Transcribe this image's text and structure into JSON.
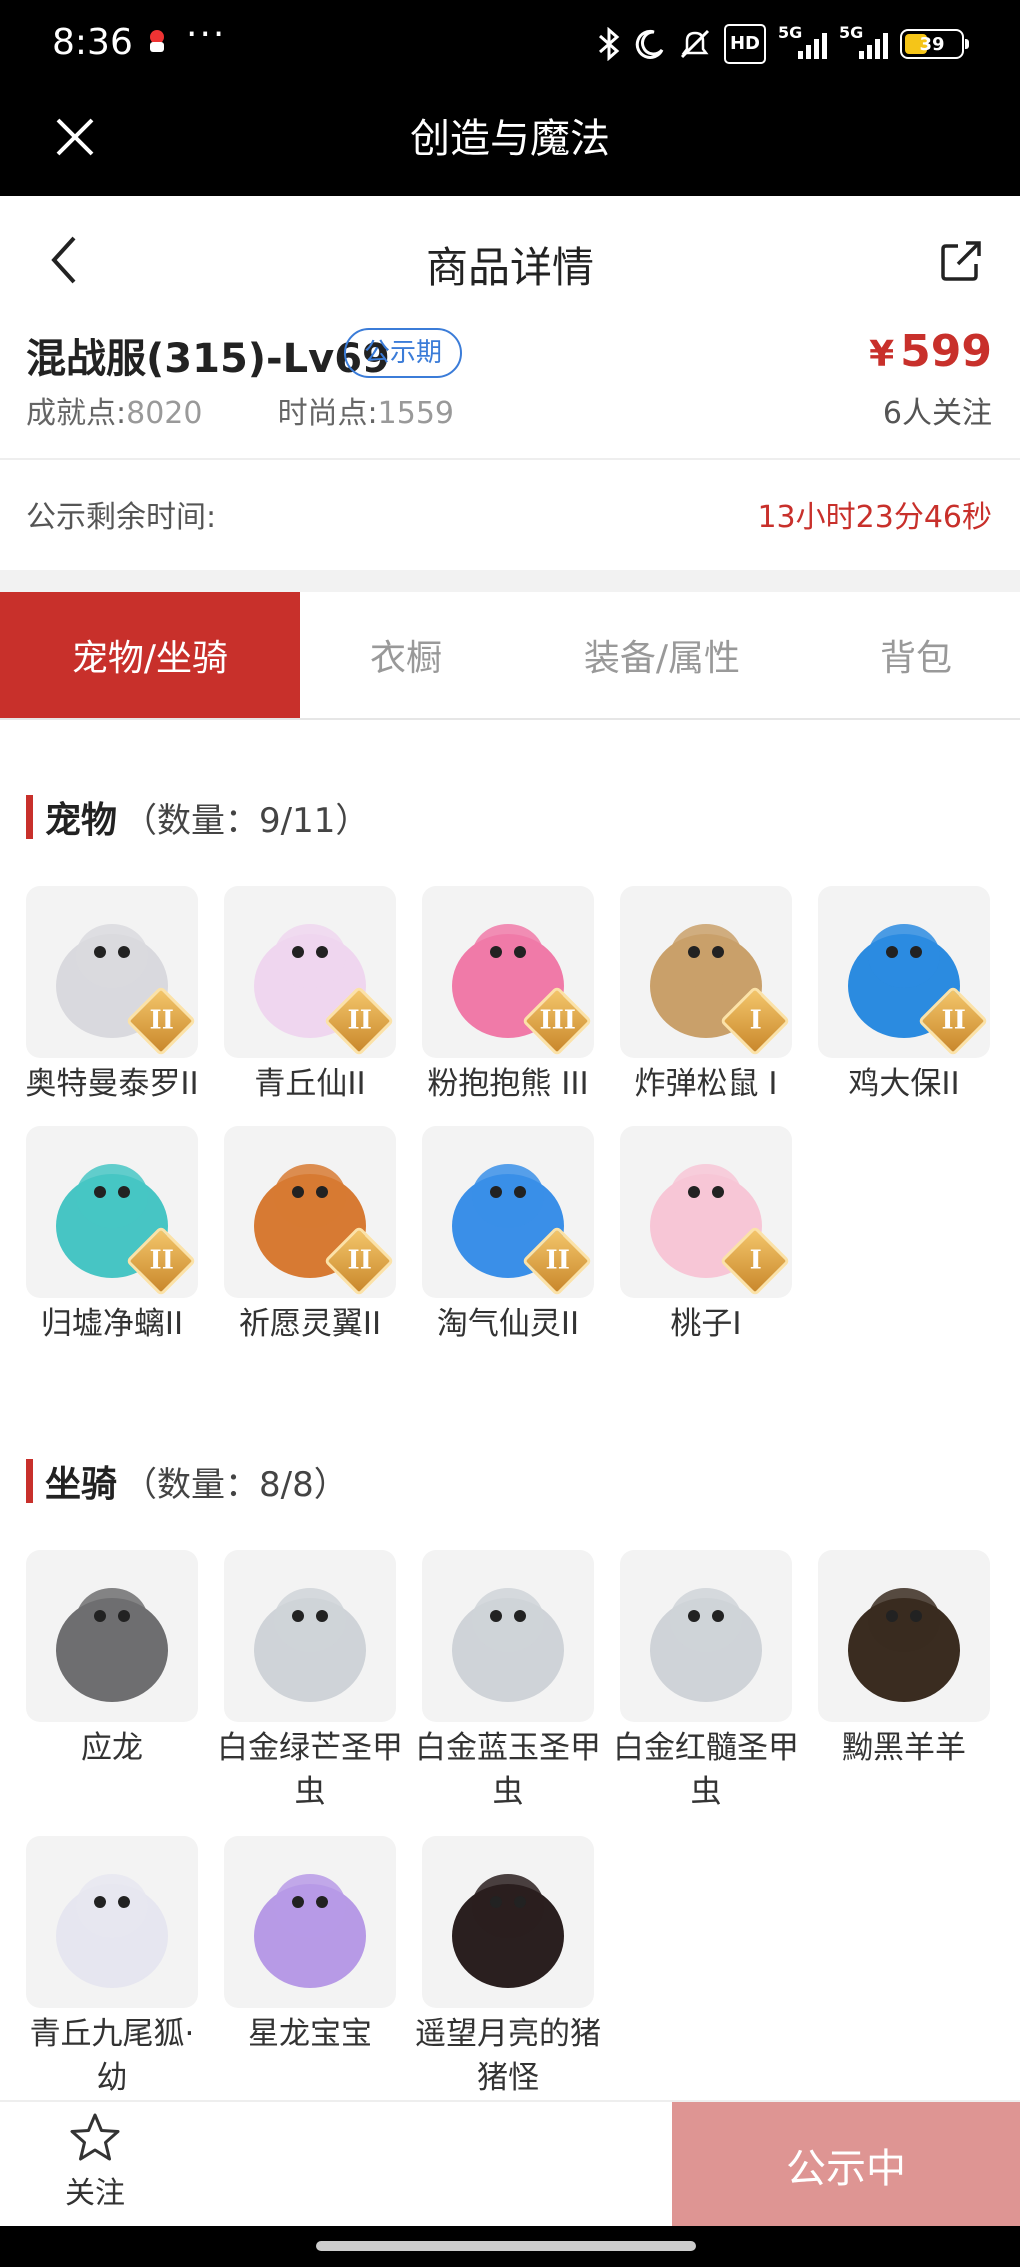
{
  "status_bar": {
    "time": "8:36",
    "dots": "···",
    "net1": "5G",
    "net2": "5G",
    "hd": "HD",
    "battery": "39"
  },
  "app_bar": {
    "title": "创造与魔法"
  },
  "header": {
    "title": "商品详情"
  },
  "product": {
    "name": "混战服(315)-Lv69",
    "badge": "公示期",
    "price_symbol": "¥",
    "price": "599",
    "achievement_label": "成就点:",
    "achievement_value": "8020",
    "fashion_label": "时尚点:",
    "fashion_value": "1559",
    "followers": "6人关注"
  },
  "remaining": {
    "label": "公示剩余时间:",
    "value": "13小时23分46秒"
  },
  "tabs": [
    "宠物/坐骑",
    "衣橱",
    "装备/属性",
    "背包"
  ],
  "pets": {
    "title": "宠物",
    "count": "（数量：9/11）",
    "items": [
      {
        "name": "奥特曼泰罗II",
        "grade": "II",
        "color": "#d9d9de"
      },
      {
        "name": "青丘仙II",
        "grade": "II",
        "color": "#efd6ef"
      },
      {
        "name": "粉抱抱熊 III",
        "grade": "III",
        "color": "#f07aa8"
      },
      {
        "name": "炸弹松鼠 I",
        "grade": "I",
        "color": "#c9a06a"
      },
      {
        "name": "鸡大保II",
        "grade": "II",
        "color": "#2b8be0"
      },
      {
        "name": "归墟净螭II",
        "grade": "II",
        "color": "#47c5c4"
      },
      {
        "name": "祈愿灵翼II",
        "grade": "II",
        "color": "#d77a33"
      },
      {
        "name": "淘气仙灵II",
        "grade": "II",
        "color": "#3a8fe8"
      },
      {
        "name": "桃子I",
        "grade": "I",
        "color": "#f7c6d6"
      }
    ]
  },
  "mounts": {
    "title": "坐骑",
    "count": "（数量：8/8）",
    "items": [
      {
        "name": "应龙",
        "color": "#6e6e70"
      },
      {
        "name": "白金绿芒圣甲虫",
        "color": "#cfd3d8"
      },
      {
        "name": "白金蓝玉圣甲虫",
        "color": "#cfd3d8"
      },
      {
        "name": "白金红髓圣甲虫",
        "color": "#cfd3d8"
      },
      {
        "name": "黝黑羊羊",
        "color": "#3a2c20"
      },
      {
        "name": "青丘九尾狐·幼",
        "color": "#e6e6f0"
      },
      {
        "name": "星龙宝宝",
        "color": "#b79ae6"
      },
      {
        "name": "遥望月亮的猪猪怪",
        "color": "#2a1f1f"
      }
    ]
  },
  "bottom": {
    "follow_label": "关注",
    "status_label": "公示中"
  }
}
